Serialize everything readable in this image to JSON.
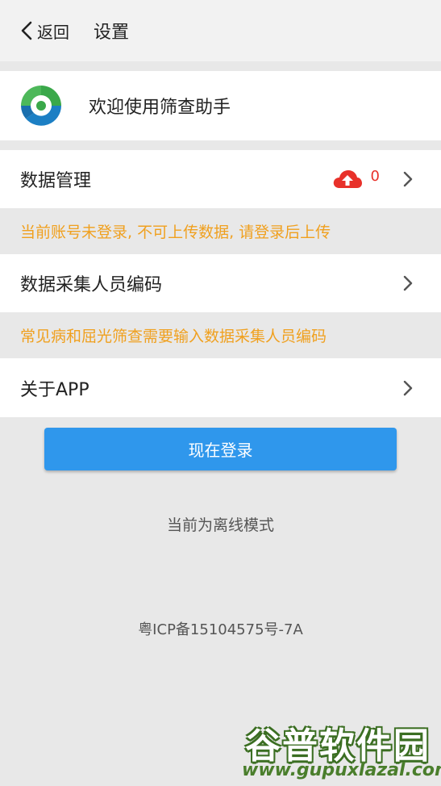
{
  "header": {
    "back_label": "返回",
    "title": "设置"
  },
  "welcome": {
    "text": "欢迎使用筛查助手"
  },
  "rows": {
    "data_management": {
      "label": "数据管理",
      "badge_count": "0"
    },
    "collector_code": {
      "label": "数据采集人员编码"
    },
    "about": {
      "label": "关于APP"
    }
  },
  "notes": {
    "not_logged_in": "当前账号未登录, 不可上传数据, 请登录后上传",
    "code_required": "常见病和屈光筛查需要输入数据采集人员编码"
  },
  "login_button": {
    "label": "现在登录"
  },
  "status": {
    "offline": "当前为离线模式"
  },
  "footer": {
    "icp": "粤ICP备15104575号-7A"
  },
  "watermark": {
    "name": "谷普软件园",
    "url": "www.gupuxlazal.com"
  },
  "colors": {
    "accent": "#2f97ec",
    "warning": "#f0a01e",
    "badge": "#e8312a"
  },
  "icons": [
    "chevron-left-icon",
    "app-logo",
    "cloud-upload-icon",
    "chevron-right-icon"
  ]
}
